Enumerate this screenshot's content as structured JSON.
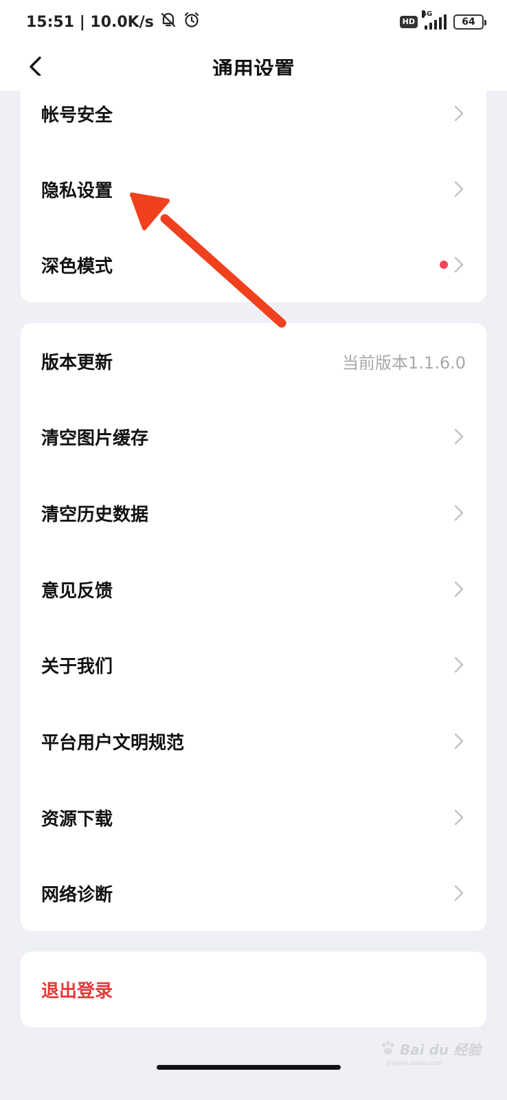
{
  "status_bar": {
    "time_speed": "15:51 | 10.0K/s",
    "hd_badge": "HD",
    "network_type": "4G",
    "battery_level": "64"
  },
  "header": {
    "title": "通用设置"
  },
  "section_account": {
    "items": [
      {
        "label": "帐号安全"
      },
      {
        "label": "隐私设置"
      },
      {
        "label": "深色模式"
      }
    ]
  },
  "section_general": {
    "version_label": "版本更新",
    "version_value": "当前版本1.1.6.0",
    "items": [
      {
        "label": "清空图片缓存"
      },
      {
        "label": "清空历史数据"
      },
      {
        "label": "意见反馈"
      },
      {
        "label": "关于我们"
      },
      {
        "label": "平台用户文明规范"
      },
      {
        "label": "资源下载"
      },
      {
        "label": "网络诊断"
      }
    ]
  },
  "logout": {
    "label": "退出登录"
  },
  "watermark": {
    "text": "Bai du 经验",
    "sub": "jingyan.baidu.com"
  },
  "colors": {
    "page_bg": "#EEF0F6",
    "card_bg": "#FFFFFF",
    "logout_red": "#E5383B",
    "badge_dot": "#F2465A",
    "annotation_arrow": "#F0401E",
    "secondary_text": "#A8A8A8"
  },
  "icons": {
    "back": "chevron-left-icon",
    "row": "chevron-right-icon",
    "mute": "bell-off-icon",
    "alarm": "alarm-icon"
  }
}
